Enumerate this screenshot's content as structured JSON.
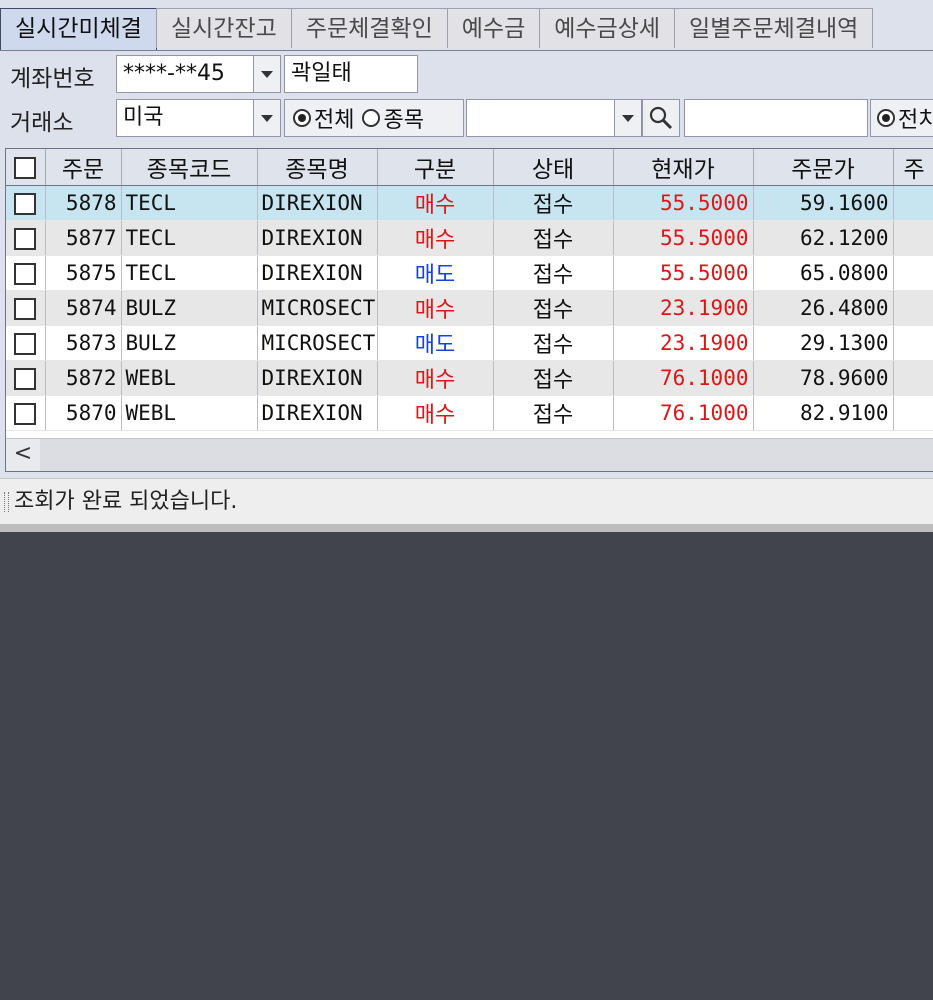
{
  "tabs": [
    {
      "label": "실시간미체결"
    },
    {
      "label": "실시간잔고"
    },
    {
      "label": "주문체결확인"
    },
    {
      "label": "예수금"
    },
    {
      "label": "예수금상세"
    },
    {
      "label": "일별주문체결내역"
    }
  ],
  "filters": {
    "account_label": "계좌번호",
    "account_value": "****-**45",
    "account_holder": "곽일태",
    "exchange_label": "거래소",
    "exchange_value": "미국",
    "scope_all": "전체",
    "scope_item": "종목",
    "symbol_value": "",
    "extra_value": "",
    "right_radio_label": "전치"
  },
  "grid": {
    "columns": [
      "",
      "주문",
      "종목코드",
      "종목명",
      "구분",
      "상태",
      "현재가",
      "주문가",
      "주"
    ],
    "rows": [
      {
        "order": "5878",
        "code": "TECL",
        "name": "DIREXION",
        "side": "매수",
        "side_type": "buy",
        "status": "접수",
        "current": "55.5000",
        "price": "59.1600"
      },
      {
        "order": "5877",
        "code": "TECL",
        "name": "DIREXION",
        "side": "매수",
        "side_type": "buy",
        "status": "접수",
        "current": "55.5000",
        "price": "62.1200"
      },
      {
        "order": "5875",
        "code": "TECL",
        "name": "DIREXION",
        "side": "매도",
        "side_type": "sell",
        "status": "접수",
        "current": "55.5000",
        "price": "65.0800"
      },
      {
        "order": "5874",
        "code": "BULZ",
        "name": "MICROSECT",
        "side": "매수",
        "side_type": "buy",
        "status": "접수",
        "current": "23.1900",
        "price": "26.4800"
      },
      {
        "order": "5873",
        "code": "BULZ",
        "name": "MICROSECT",
        "side": "매도",
        "side_type": "sell",
        "status": "접수",
        "current": "23.1900",
        "price": "29.1300"
      },
      {
        "order": "5872",
        "code": "WEBL",
        "name": "DIREXION",
        "side": "매수",
        "side_type": "buy",
        "status": "접수",
        "current": "76.1000",
        "price": "78.9600"
      },
      {
        "order": "5870",
        "code": "WEBL",
        "name": "DIREXION",
        "side": "매수",
        "side_type": "buy",
        "status": "접수",
        "current": "76.1000",
        "price": "82.9100"
      }
    ]
  },
  "status_message": "조회가 완료 되었습니다.",
  "colors": {
    "buy": "#e01616",
    "sell": "#1345d6",
    "selected_row": "#c6e5f0"
  }
}
